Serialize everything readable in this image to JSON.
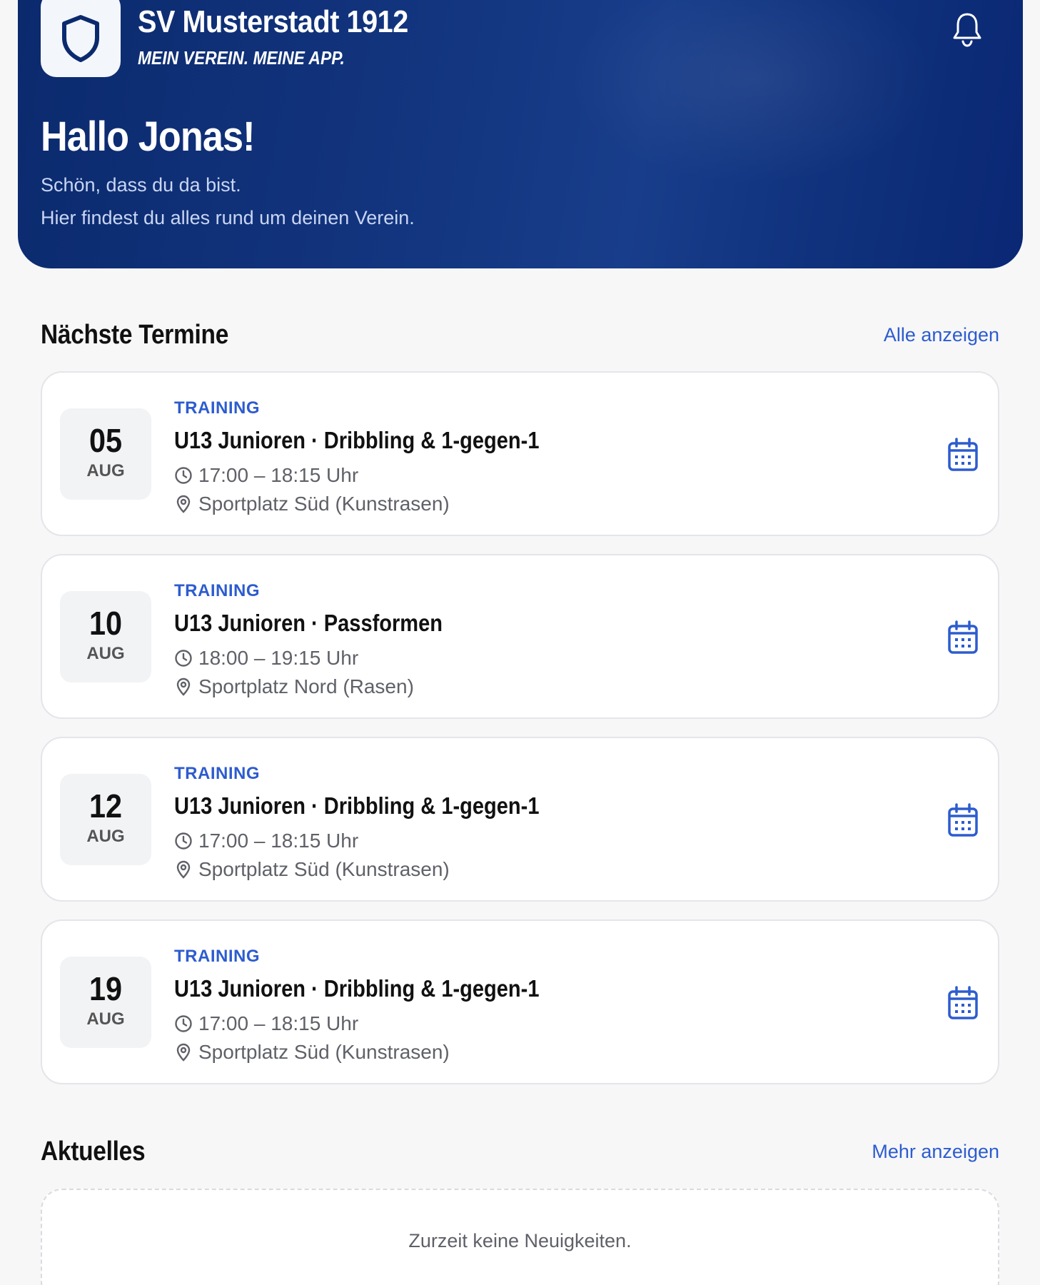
{
  "header": {
    "club_name": "SV Musterstadt 1912",
    "slogan": "MEIN VEREIN. MEINE APP.",
    "greeting": "Hallo Jonas!",
    "subtitle_1": "Schön, dass du da bist.",
    "subtitle_2": "Hier findest du alles rund um deinen Verein.",
    "icons": {
      "logo": "shield-icon",
      "notifications": "bell-icon"
    }
  },
  "events_section": {
    "title": "Nächste Termine",
    "link": "Alle anzeigen",
    "items": [
      {
        "day": "05",
        "month": "AUG",
        "type": "TRAINING",
        "title": "U13 Junioren · Dribbling & 1-gegen-1",
        "time": "17:00 – 18:15 Uhr",
        "place": "Sportplatz Süd (Kunstrasen)"
      },
      {
        "day": "10",
        "month": "AUG",
        "type": "TRAINING",
        "title": "U13 Junioren · Passformen",
        "time": "18:00 – 19:15 Uhr",
        "place": "Sportplatz Nord (Rasen)"
      },
      {
        "day": "12",
        "month": "AUG",
        "type": "TRAINING",
        "title": "U13 Junioren · Dribbling & 1-gegen-1",
        "time": "17:00 – 18:15 Uhr",
        "place": "Sportplatz Süd (Kunstrasen)"
      },
      {
        "day": "19",
        "month": "AUG",
        "type": "TRAINING",
        "title": "U13 Junioren · Dribbling & 1-gegen-1",
        "time": "17:00 – 18:15 Uhr",
        "place": "Sportplatz Süd (Kunstrasen)"
      }
    ]
  },
  "news_section": {
    "title": "Aktuelles",
    "link": "Mehr anzeigen",
    "empty_text": "Zurzeit keine Neuigkeiten."
  },
  "colors": {
    "header_bg": "#13357f",
    "accent": "#2d5ccf",
    "card_bg": "#ffffff",
    "page_bg": "#f7f7f8"
  }
}
